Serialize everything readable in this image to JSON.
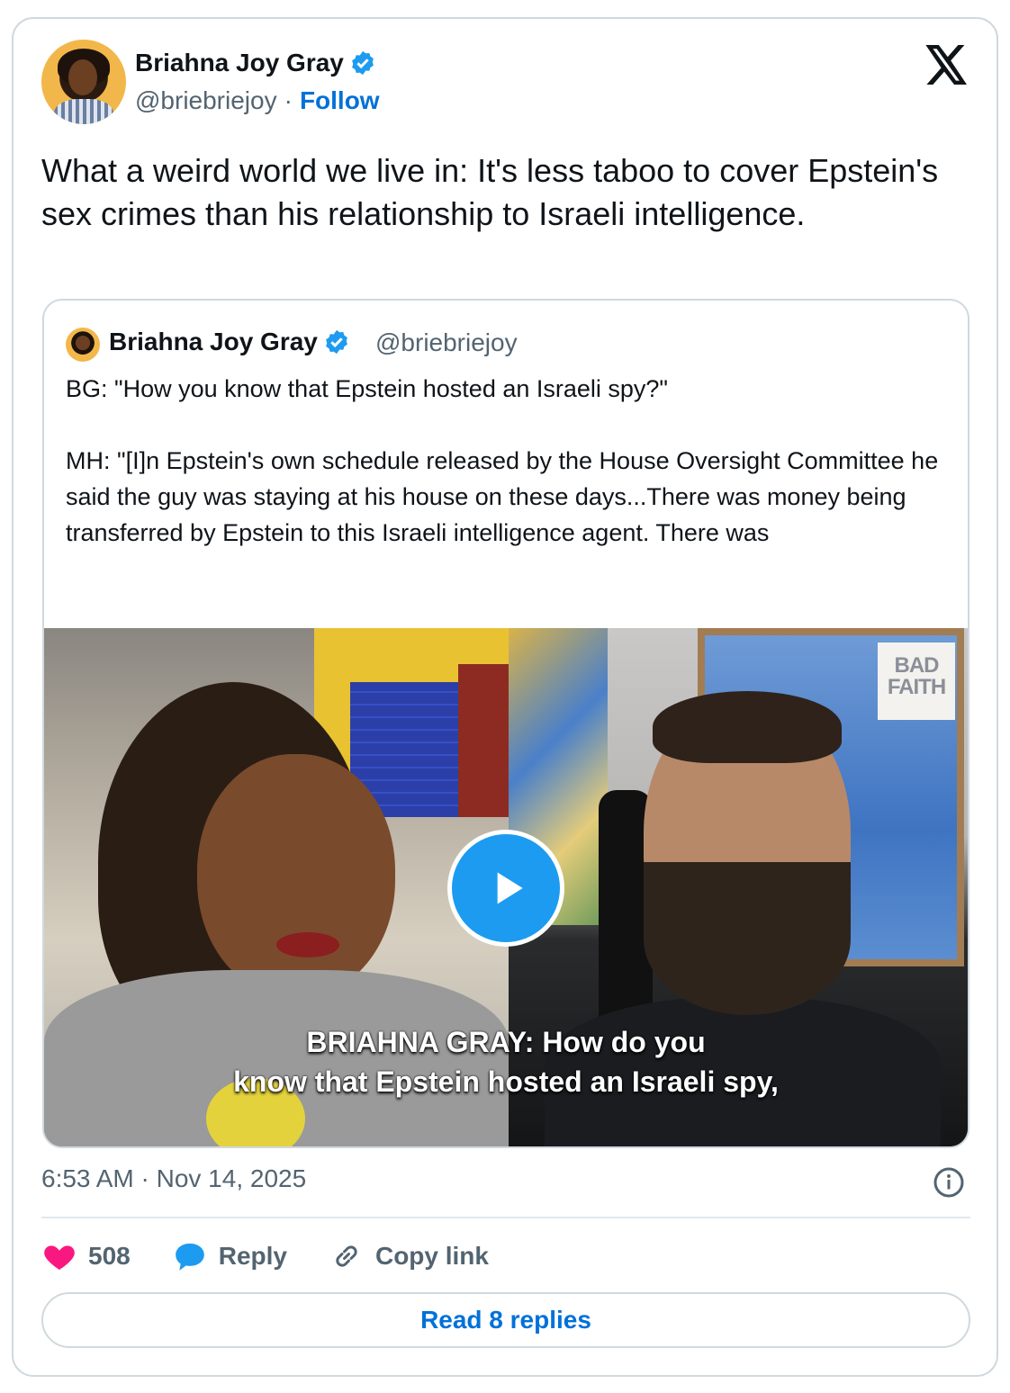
{
  "author": {
    "name": "Briahna Joy Gray",
    "handle": "@briebriejoy",
    "separator": "·",
    "follow_label": "Follow"
  },
  "tweet": {
    "text": "What a weird world we live in: It's less taboo to cover Epstein's sex crimes than his relationship to Israeli intelligence."
  },
  "quoted": {
    "name": "Briahna Joy Gray",
    "handle": "@briebriejoy",
    "text": "BG: \"How you know that Epstein hosted an Israeli spy?\"\n\nMH: \"[I]n Epstein's own schedule released by the House Oversight Committee he said the guy was staying at his house on these days...There was money being transferred by Epstein to this Israeli intelligence agent. There was",
    "video": {
      "watermark_line1": "BAD",
      "watermark_line2": "FAITH",
      "caption_line1": "BRIAHNA GRAY: How do you",
      "caption_line2": "know that Epstein hosted an Israeli spy,"
    }
  },
  "timestamp": "6:53 AM · Nov 14, 2025",
  "actions": {
    "likes_count": "508",
    "reply_label": "Reply",
    "copy_link_label": "Copy link"
  },
  "read_replies_label": "Read 8 replies",
  "colors": {
    "accent": "#0071d9",
    "like": "#f91880",
    "verified": "#1d9bf0",
    "muted_text": "#536471",
    "border": "#cfd9de"
  },
  "icons": [
    "verified-badge-icon",
    "x-logo-icon",
    "play-icon",
    "info-icon",
    "heart-icon",
    "reply-bubble-icon",
    "link-icon"
  ]
}
